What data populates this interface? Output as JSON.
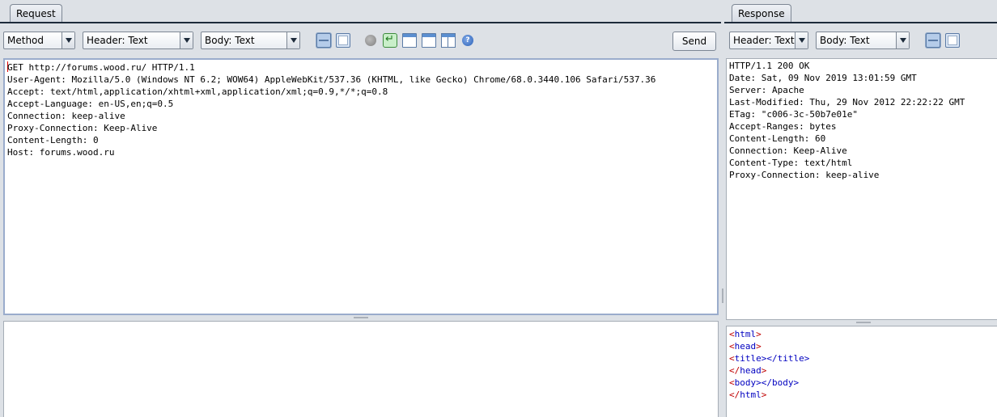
{
  "request": {
    "tab_label": "Request",
    "toolbar": {
      "method_label": "Method",
      "header_label": "Header: Text",
      "body_label": "Body: Text",
      "send_label": "Send",
      "icons": [
        "split-horizontal-icon",
        "split-vertical-icon",
        "stop-icon",
        "return-icon",
        "window-icon",
        "list-window-icon",
        "columns-icon",
        "help-icon"
      ]
    },
    "headers": [
      "GET http://forums.wood.ru/ HTTP/1.1",
      "User-Agent: Mozilla/5.0 (Windows NT 6.2; WOW64) AppleWebKit/537.36 (KHTML, like Gecko) Chrome/68.0.3440.106 Safari/537.36",
      "Accept: text/html,application/xhtml+xml,application/xml;q=0.9,*/*;q=0.8",
      "Accept-Language: en-US,en;q=0.5",
      "Connection: keep-alive",
      "Proxy-Connection: Keep-Alive",
      "Content-Length: 0",
      "Host: forums.wood.ru"
    ],
    "body": ""
  },
  "response": {
    "tab_label": "Response",
    "toolbar": {
      "header_label": "Header: Text",
      "body_label": "Body: Text",
      "icons": [
        "split-horizontal-icon",
        "split-vertical-icon"
      ]
    },
    "headers": [
      "HTTP/1.1 200 OK",
      "Date: Sat, 09 Nov 2019 13:01:59 GMT",
      "Server: Apache",
      "Last-Modified: Thu, 29 Nov 2012 22:22:22 GMT",
      "ETag: \"c006-3c-50b7e01e\"",
      "Accept-Ranges: bytes",
      "Content-Length: 60",
      "Connection: Keep-Alive",
      "Content-Type: text/html",
      "Proxy-Connection: keep-alive"
    ],
    "body_lines": [
      {
        "open": "<",
        "name": "html",
        "close": ">"
      },
      {
        "open": "<",
        "name": "head",
        "close": ">"
      },
      {
        "open": "<",
        "name": "title",
        "close": "></title>"
      },
      {
        "open": "</",
        "name": "head",
        "close": ">"
      },
      {
        "open": "<",
        "name": "body",
        "close": "></body>"
      },
      {
        "open": "</",
        "name": "html",
        "close": ">"
      }
    ]
  },
  "colors": {
    "tag_bracket": "#c00000",
    "tag_name": "#0000c0",
    "background": "#dde1e6"
  }
}
